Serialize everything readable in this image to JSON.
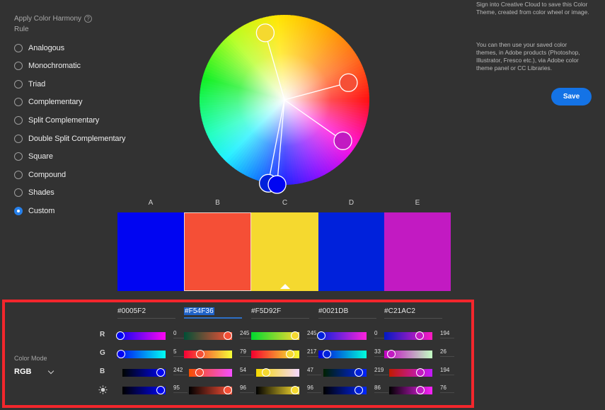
{
  "harmony": {
    "title": "Apply Color Harmony Rule",
    "help_icon": "question-circle-icon",
    "rules": [
      {
        "label": "Analogous",
        "selected": false
      },
      {
        "label": "Monochromatic",
        "selected": false
      },
      {
        "label": "Triad",
        "selected": false
      },
      {
        "label": "Complementary",
        "selected": false
      },
      {
        "label": "Split Complementary",
        "selected": false
      },
      {
        "label": "Double Split Complementary",
        "selected": false
      },
      {
        "label": "Square",
        "selected": false
      },
      {
        "label": "Compound",
        "selected": false
      },
      {
        "label": "Shades",
        "selected": false
      },
      {
        "label": "Custom",
        "selected": true
      }
    ]
  },
  "wheel": {
    "handles": [
      {
        "swatch": "A",
        "color": "#0005F2",
        "hue_deg": 265,
        "saturation": 1.0
      },
      {
        "swatch": "B",
        "color": "#F54F36",
        "hue_deg": 15,
        "saturation": 0.78
      },
      {
        "swatch": "C",
        "color": "#F5D92F",
        "hue_deg": 106,
        "saturation": 0.82,
        "base": true
      },
      {
        "swatch": "D",
        "color": "#0021DB",
        "hue_deg": 259,
        "saturation": 1.0
      },
      {
        "swatch": "E",
        "color": "#C21AC2",
        "hue_deg": 325,
        "saturation": 0.84
      }
    ]
  },
  "swatches": [
    {
      "letter": "A",
      "color": "#0005F2",
      "selected": false,
      "base": false
    },
    {
      "letter": "B",
      "color": "#F54F36",
      "selected": true,
      "base": false
    },
    {
      "letter": "C",
      "color": "#F5D92F",
      "selected": false,
      "base": true
    },
    {
      "letter": "D",
      "color": "#0021DB",
      "selected": false,
      "base": false
    },
    {
      "letter": "E",
      "color": "#C21AC2",
      "selected": false,
      "base": false
    }
  ],
  "editor": {
    "color_mode_label": "Color Mode",
    "color_mode_value": "RGB",
    "channel_labels": [
      "R",
      "G",
      "B"
    ],
    "brightness_icon": "brightness-sun-icon",
    "columns": [
      {
        "hex": "#0005F2",
        "active": false,
        "r": 0,
        "g": 5,
        "b": 242,
        "brightness": 95
      },
      {
        "hex": "#F54F36",
        "active": true,
        "r": 245,
        "g": 79,
        "b": 54,
        "brightness": 96
      },
      {
        "hex": "#F5D92F",
        "active": false,
        "r": 245,
        "g": 217,
        "b": 47,
        "brightness": 96
      },
      {
        "hex": "#0021DB",
        "active": false,
        "r": 0,
        "g": 33,
        "b": 219,
        "brightness": 86
      },
      {
        "hex": "#C21AC2",
        "active": false,
        "r": 194,
        "g": 26,
        "b": 194,
        "brightness": 76
      }
    ]
  },
  "info": {
    "paragraph1": "Sign into Creative Cloud to save this Color Theme, created from color wheel or image.",
    "paragraph2": "You can then use your saved color themes, in Adobe products (Photoshop, Illustrator, Fresco etc.), via Adobe color theme panel or CC Libraries.",
    "save_label": "Save"
  },
  "colors": {
    "background": "#323232",
    "accent": "#1473E6",
    "highlight_border": "#F3262C"
  }
}
